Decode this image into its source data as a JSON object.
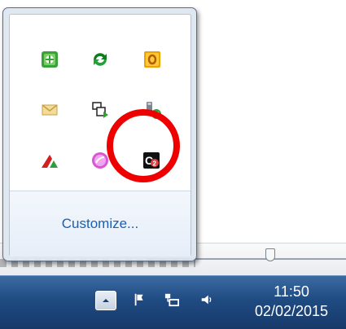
{
  "tray_popup": {
    "icons": [
      {
        "name": "shield-app-icon",
        "color": "#3aa23a"
      },
      {
        "name": "green-arrows-icon",
        "color": "#0f7a1e"
      },
      {
        "name": "orange-o-icon",
        "color": "#f0a000"
      },
      {
        "name": "envelope-icon",
        "color": "#e4c77a"
      },
      {
        "name": "network-devices-icon",
        "color": "#2d2d2d"
      },
      {
        "name": "usb-safe-remove-icon",
        "color": "#3a9b3a"
      },
      {
        "name": "red-green-pyramid-icon",
        "color": "#d11f1f"
      },
      {
        "name": "pink-bubble-icon",
        "color": "#d957d4"
      },
      {
        "name": "c2-app-icon",
        "color": "#111111"
      }
    ],
    "customize_label": "Customize..."
  },
  "taskbar": {
    "time": "11:50",
    "date": "02/02/2015",
    "icons": [
      "chevron-up-icon",
      "flag-icon",
      "network-icon",
      "speaker-icon"
    ]
  },
  "colors": {
    "taskbar": "#1f4b82",
    "highlight": "#ee0000",
    "link": "#1a5fb4"
  }
}
